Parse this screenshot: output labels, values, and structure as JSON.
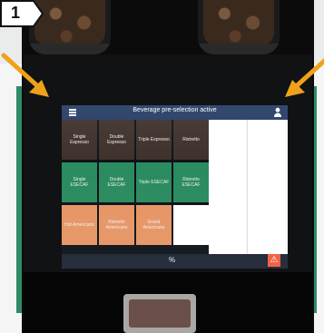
{
  "callout": {
    "number": "1"
  },
  "screen": {
    "title": "Beverage pre-selection active",
    "tiles": [
      {
        "label": "Single Espresso",
        "variant": "dark"
      },
      {
        "label": "Double Espresso",
        "variant": "dark"
      },
      {
        "label": "Triple Espresso",
        "variant": "dark"
      },
      {
        "label": "Ristretto",
        "variant": "dark"
      },
      {
        "label": "Single ESECAF",
        "variant": "green"
      },
      {
        "label": "Double ESECAF",
        "variant": "green"
      },
      {
        "label": "Triple ESECAF",
        "variant": "green"
      },
      {
        "label": "Ristretto ESECAF",
        "variant": "green"
      },
      {
        "label": "Hot Americano",
        "variant": "orange"
      },
      {
        "label": "Ristretto Americano",
        "variant": "orange"
      },
      {
        "label": "Grand Americano",
        "variant": "orange"
      },
      {
        "label": "",
        "variant": "white"
      }
    ],
    "bottom": {
      "percent": "%"
    },
    "icons": {
      "menu": "menu-icon",
      "user": "user-icon",
      "warning": "warning-icon"
    }
  }
}
